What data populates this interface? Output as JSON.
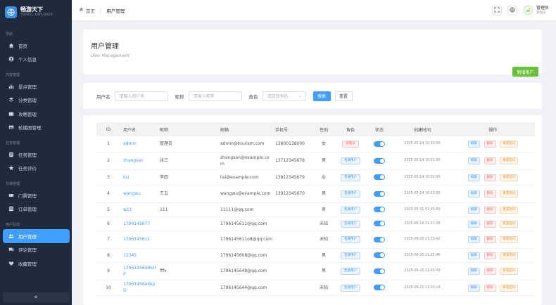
{
  "brand": {
    "title": "畅游天下",
    "subtitle": "TRAVEL EXPLORER"
  },
  "sidebar": {
    "groups": [
      {
        "label": "导航",
        "items": [
          {
            "label": "首页",
            "icon": "home-icon"
          },
          {
            "label": "个人信息",
            "icon": "user-circle-icon"
          }
        ]
      },
      {
        "label": "内容管理",
        "items": [
          {
            "label": "景点管理",
            "icon": "chart-icon"
          },
          {
            "label": "分类管理",
            "icon": "layers-icon"
          },
          {
            "label": "攻略管理",
            "icon": "book-icon"
          },
          {
            "label": "轮播图管理",
            "icon": "image-icon"
          }
        ]
      },
      {
        "label": "任务管理",
        "items": [
          {
            "label": "任务管理",
            "icon": "task-icon"
          },
          {
            "label": "任务评价",
            "icon": "star-icon"
          }
        ]
      },
      {
        "label": "交易管理",
        "items": [
          {
            "label": "门票管理",
            "icon": "ticket-icon"
          },
          {
            "label": "订单管理",
            "icon": "order-icon"
          }
        ]
      },
      {
        "label": "用户互动",
        "items": [
          {
            "label": "用户管理",
            "icon": "users-icon",
            "active": true
          },
          {
            "label": "评论管理",
            "icon": "comment-icon"
          },
          {
            "label": "收藏管理",
            "icon": "heart-icon"
          }
        ]
      }
    ],
    "collapse_label": "«"
  },
  "header": {
    "breadcrumb_home": "首页",
    "breadcrumb_sep": "/",
    "breadcrumb_current": "用户管理",
    "user_name": "管理员",
    "user_role": "管理员"
  },
  "page": {
    "title": "用户管理",
    "subtitle": "User Management",
    "add_button": "新增用户"
  },
  "filter": {
    "username_label": "用户名",
    "username_placeholder": "请输入用户名",
    "nickname_label": "昵称",
    "nickname_placeholder": "请输入昵称",
    "role_label": "角色",
    "role_placeholder": "请选择角色",
    "search_button": "搜索",
    "reset_button": "重置"
  },
  "table": {
    "columns": [
      "ID",
      "用户名",
      "昵称",
      "邮箱",
      "手机号",
      "性别",
      "角色",
      "状态",
      "创建时间",
      "操作"
    ],
    "op_labels": {
      "edit": "编辑",
      "delete": "删除",
      "reset": "重置密码"
    },
    "rows": [
      {
        "id": "1",
        "username": "admin",
        "nickname": "管理员",
        "email": "admin@tourism.com",
        "phone": "13800138000",
        "gender": "女",
        "role": "管理员",
        "role_type": "admin",
        "status_on": true,
        "created": "2025-05-14 10:00:00"
      },
      {
        "id": "2",
        "username": "zhangsan",
        "nickname": "张三",
        "email": "zhangsan@example.com",
        "phone": "13712345678",
        "gender": "男",
        "role": "普通用户",
        "role_type": "user",
        "status_on": true,
        "created": "2025-05-14 10:01:00"
      },
      {
        "id": "3",
        "username": "lisi",
        "nickname": "李四",
        "email": "lisi@example.com",
        "phone": "13812345679",
        "gender": "女",
        "role": "普通用户",
        "role_type": "user",
        "status_on": true,
        "created": "2025-05-14 10:02:00"
      },
      {
        "id": "4",
        "username": "wangwu",
        "nickname": "王五",
        "email": "wangwu@example.com",
        "phone": "13912345670",
        "gender": "男",
        "role": "普通用户",
        "role_type": "user",
        "status_on": true,
        "created": "2025-05-14 10:03:00"
      },
      {
        "id": "5",
        "username": "w11",
        "nickname": "111",
        "email": "11111@qq.com",
        "phone": "",
        "gender": "男",
        "role": "普通用户",
        "role_type": "user",
        "status_on": true,
        "created": "2025-05-31 01:45:50"
      },
      {
        "id": "6",
        "username": "1796145677",
        "nickname": "",
        "email": "1796145611@qq.com",
        "phone": "",
        "gender": "未知",
        "role": "普通用户",
        "role_type": "user",
        "status_on": true,
        "created": "2025-06-19 21:31:58"
      },
      {
        "id": "7",
        "username": "1796145611",
        "nickname": "",
        "email": "1796145611o8@qq.com",
        "phone": "",
        "gender": "未知",
        "role": "普通用户",
        "role_type": "user",
        "status_on": true,
        "created": "2025-06-20 21:30:42"
      },
      {
        "id": "8",
        "username": "12345",
        "nickname": "",
        "email": "1796145608@qq.com",
        "phone": "",
        "gender": "男",
        "role": "普通用户",
        "role_type": "user",
        "status_on": true,
        "created": "2025-06-20 21:35:46"
      },
      {
        "id": "9",
        "username": "1796145648SHP",
        "nickname": "fffx",
        "email": "1796145648@qq.com",
        "phone": "",
        "gender": "男",
        "role": "普通用户",
        "role_type": "user",
        "status_on": true,
        "created": "2025-06-20 21:43:43"
      },
      {
        "id": "10",
        "username": "1796145644kpD",
        "nickname": "",
        "email": "1796145644@qq.com",
        "phone": "",
        "gender": "未知",
        "role": "普通用户",
        "role_type": "user",
        "status_on": true,
        "created": "2025-06-21 11:23:14"
      }
    ]
  },
  "colors": {
    "sidebar_bg": "#1f2a3d",
    "accent": "#409eff",
    "success": "#67c23a",
    "danger": "#f56c6c",
    "warning": "#e6a23c"
  }
}
